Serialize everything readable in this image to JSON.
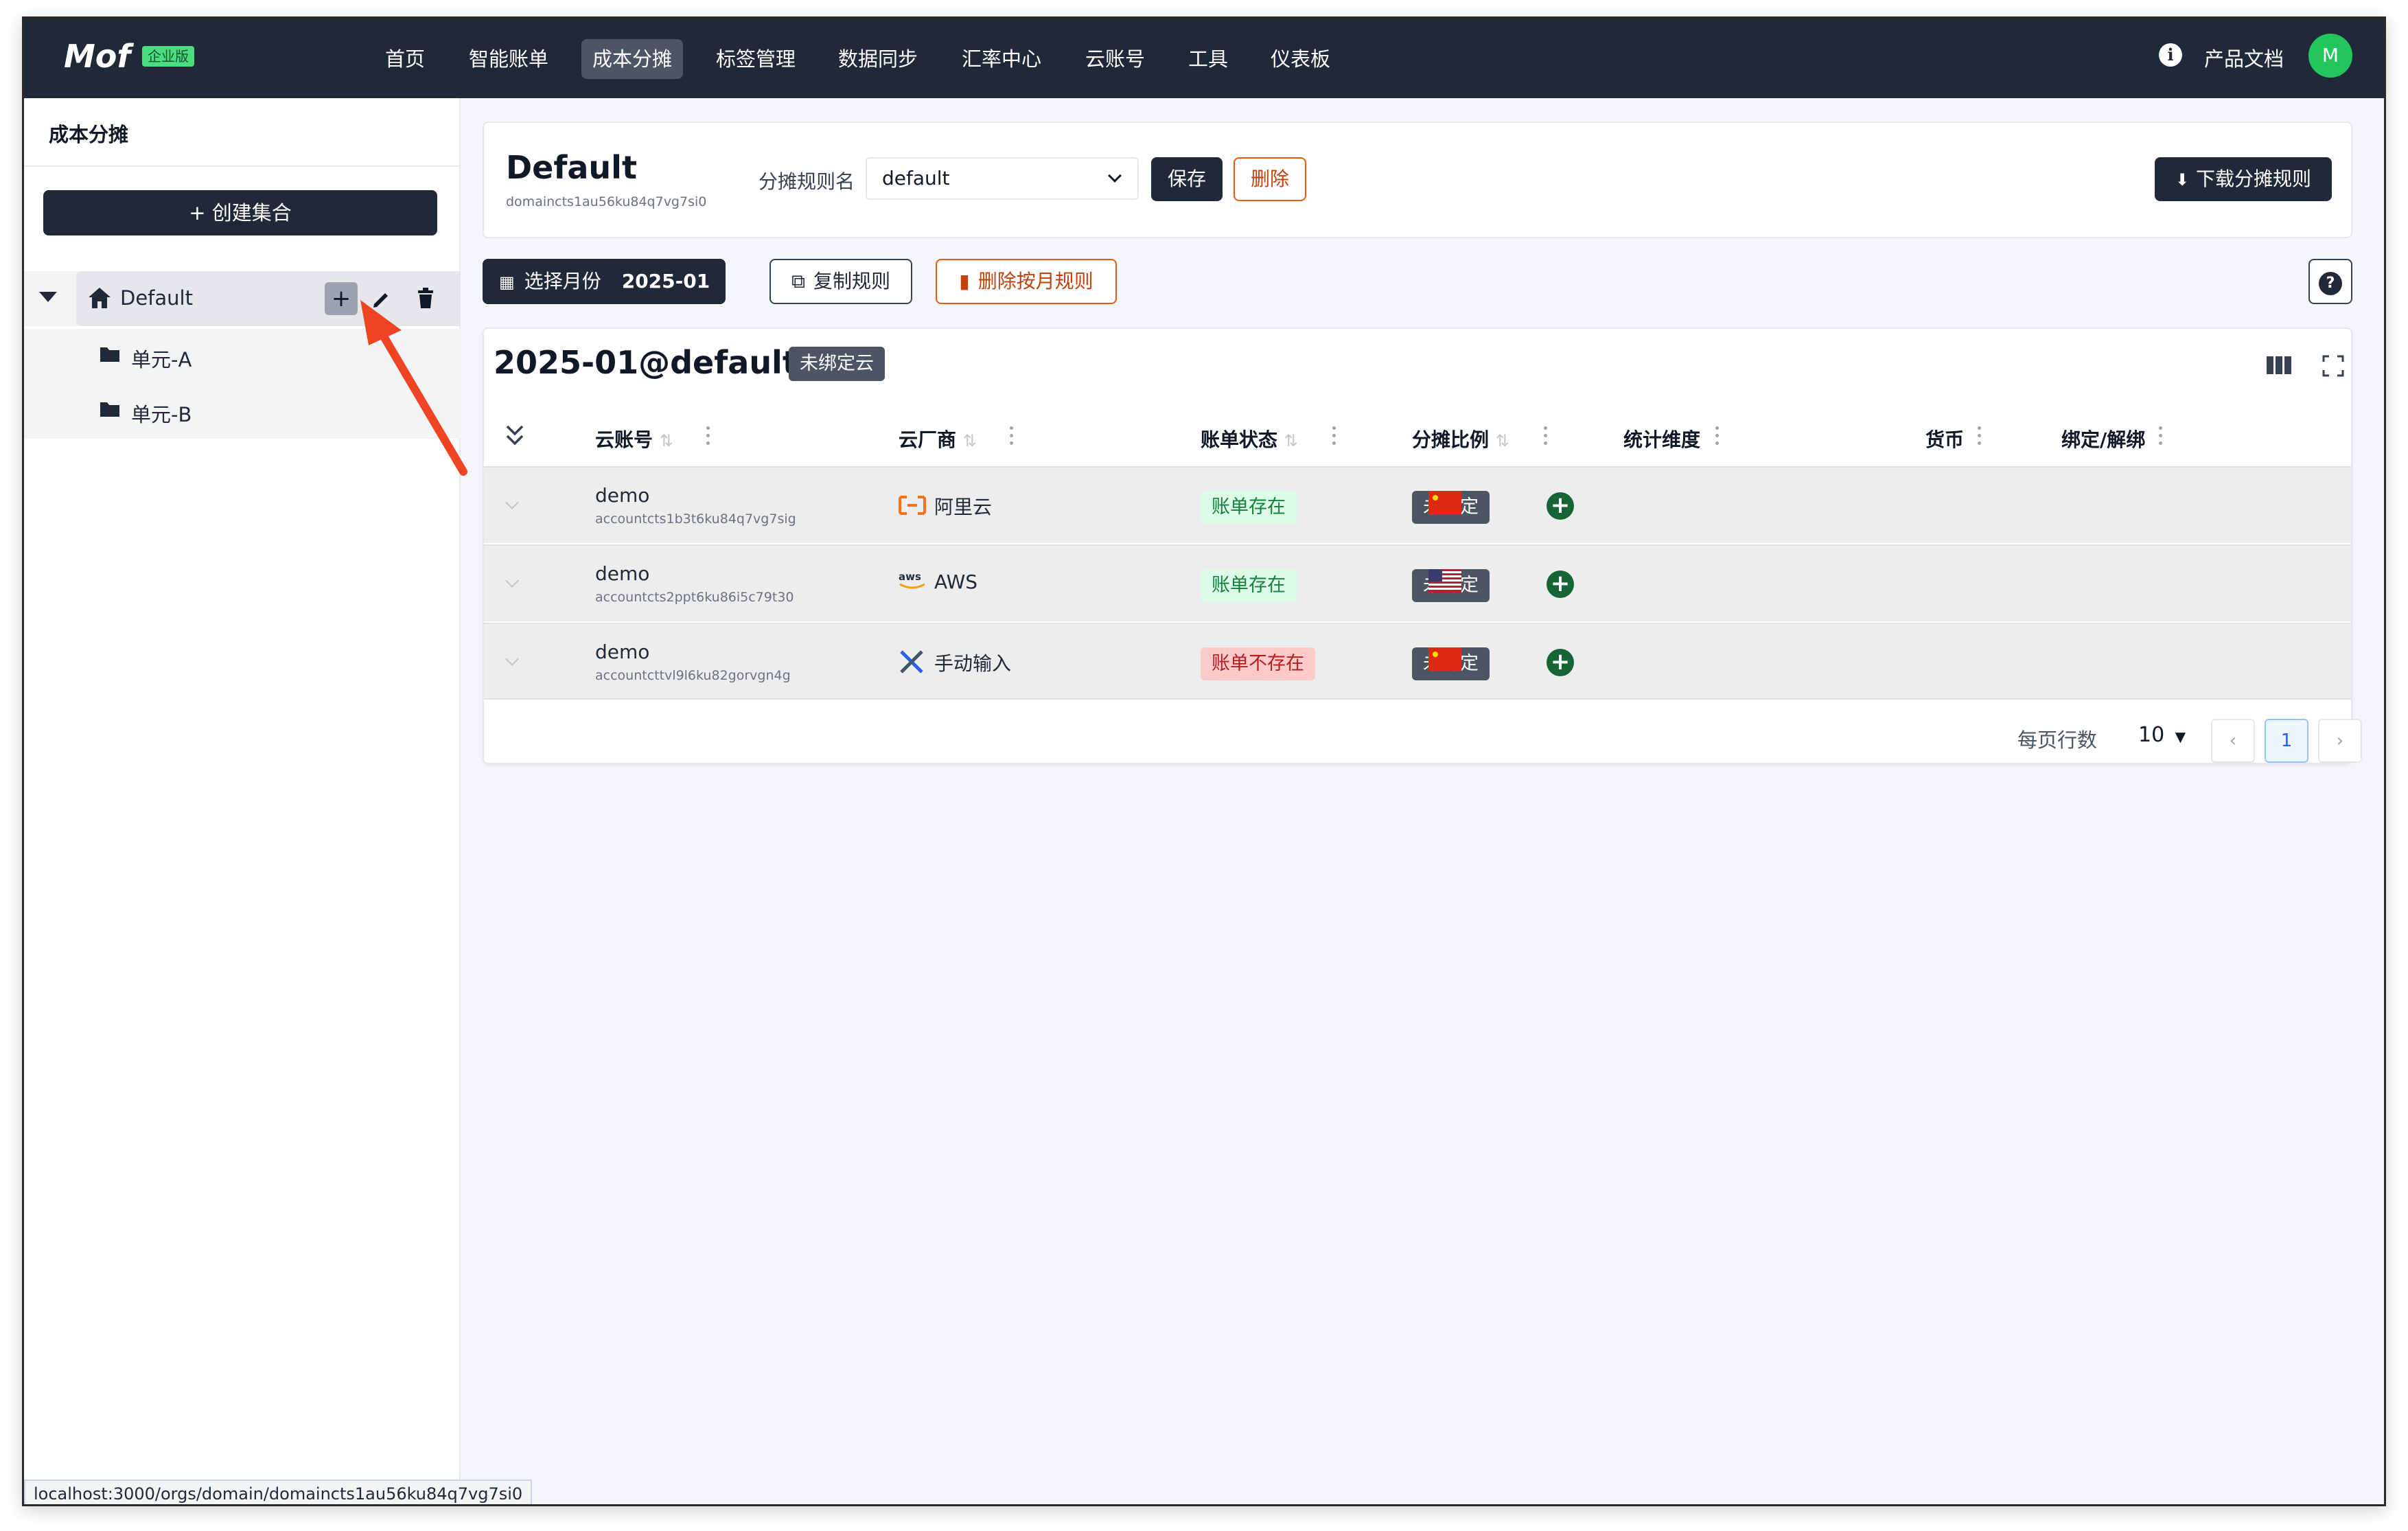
{
  "brand": {
    "logo": "Mof",
    "edition": "企业版"
  },
  "nav": {
    "items": [
      "首页",
      "智能账单",
      "成本分摊",
      "标签管理",
      "数据同步",
      "汇率中心",
      "云账号",
      "工具",
      "仪表板"
    ],
    "active": "成本分摊",
    "docs": "产品文档",
    "avatar_initial": "M"
  },
  "sidebar": {
    "title": "成本分摊",
    "create_button": "+ 创建集合",
    "tree": {
      "root": {
        "label": "Default",
        "icon": "home-icon"
      },
      "children": [
        {
          "label": "单元-A",
          "icon": "folder-icon"
        },
        {
          "label": "单元-B",
          "icon": "folder-icon"
        }
      ],
      "tools": [
        "plus-icon",
        "pencil-icon",
        "trash-icon"
      ]
    }
  },
  "header": {
    "title": "Default",
    "subtitle": "domaincts1au56ku84q7vg7si0",
    "rule_label": "分摊规则名",
    "rule_value": "default",
    "save": "保存",
    "delete": "删除",
    "download": "下载分摊规则"
  },
  "toolbar": {
    "month_label": "选择月份",
    "month_value": "2025-01",
    "copy_rule": "复制规则",
    "delete_by_month": "删除按月规则",
    "help": "?"
  },
  "table": {
    "title": "2025-01@default",
    "title_badge": "未绑定云",
    "columns": [
      "云账号",
      "云厂商",
      "账单状态",
      "分摊比例",
      "统计维度",
      "货币",
      "绑定/解绑"
    ],
    "rows": [
      {
        "name": "demo",
        "id": "accountcts1b3t6ku84q7vg7sig",
        "vendor": "阿里云",
        "vendor_icon": "aliyun-icon",
        "bill_status": "账单存在",
        "bill_ok": true,
        "ratio": "未绑定",
        "currency_flag": "china-flag-icon"
      },
      {
        "name": "demo",
        "id": "accountcts2ppt6ku86i5c79t30",
        "vendor": "AWS",
        "vendor_icon": "aws-icon",
        "bill_status": "账单存在",
        "bill_ok": true,
        "ratio": "未绑定",
        "currency_flag": "us-flag-icon"
      },
      {
        "name": "demo",
        "id": "accountcttvl9l6ku82gorvgn4g",
        "vendor": "手动输入",
        "vendor_icon": "tools-icon",
        "bill_status": "账单不存在",
        "bill_ok": false,
        "ratio": "未绑定",
        "currency_flag": "china-flag-icon"
      }
    ],
    "pager": {
      "rows_label": "每页行数",
      "rows_value": "10",
      "current_page": "1"
    }
  },
  "statusbar": {
    "url": "localhost:3000/orgs/domain/domaincts1au56ku84q7vg7si0"
  },
  "colors": {
    "nav_bg": "#1f2937",
    "accent_green": "#22c55e",
    "danger": "#ea580c",
    "arrow": "#ef4423"
  }
}
